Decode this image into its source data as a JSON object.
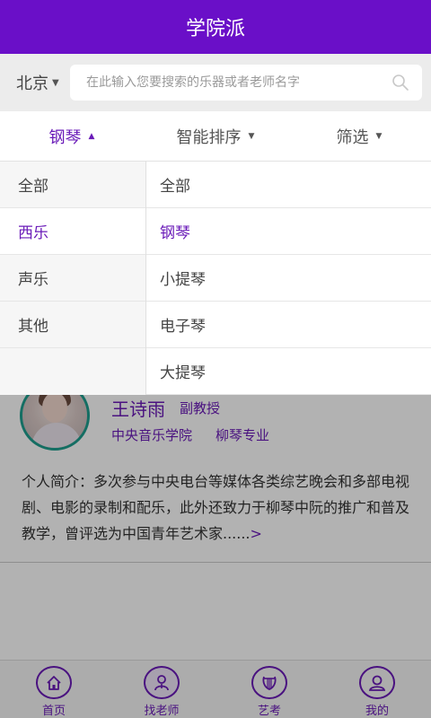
{
  "header": {
    "title": "学院派"
  },
  "search": {
    "city": "北京",
    "placeholder": "在此输入您要搜索的乐器或者老师名字"
  },
  "filters": [
    {
      "label": "钢琴",
      "active": true
    },
    {
      "label": "智能排序",
      "active": false
    },
    {
      "label": "筛选",
      "active": false
    }
  ],
  "dropdown": {
    "categories": [
      "全部",
      "西乐",
      "声乐",
      "其他"
    ],
    "selected_category": "西乐",
    "subcategories": [
      "全部",
      "钢琴",
      "小提琴",
      "电子琴",
      "大提琴"
    ],
    "selected_subcategory": "钢琴"
  },
  "teacher": {
    "name": "王诗雨",
    "title": "副教授",
    "school": "中央音乐学院",
    "major": "柳琴专业",
    "bio": "个人简介：多次参与中央电台等媒体各类综艺晚会和多部电视剧、电影的录制和配乐，此外还致力于柳琴中阮的推广和普及教学，曾评选为中国青年艺术家......",
    "more": ">"
  },
  "tabbar": [
    {
      "label": "首页",
      "icon": "home-icon"
    },
    {
      "label": "找老师",
      "icon": "teacher-icon"
    },
    {
      "label": "艺考",
      "icon": "lyre-icon"
    },
    {
      "label": "我的",
      "icon": "user-icon"
    }
  ],
  "colors": {
    "brand": "#6a0fc8",
    "accent": "#6a1bb8",
    "avatar_ring": "#1e9e8e"
  }
}
